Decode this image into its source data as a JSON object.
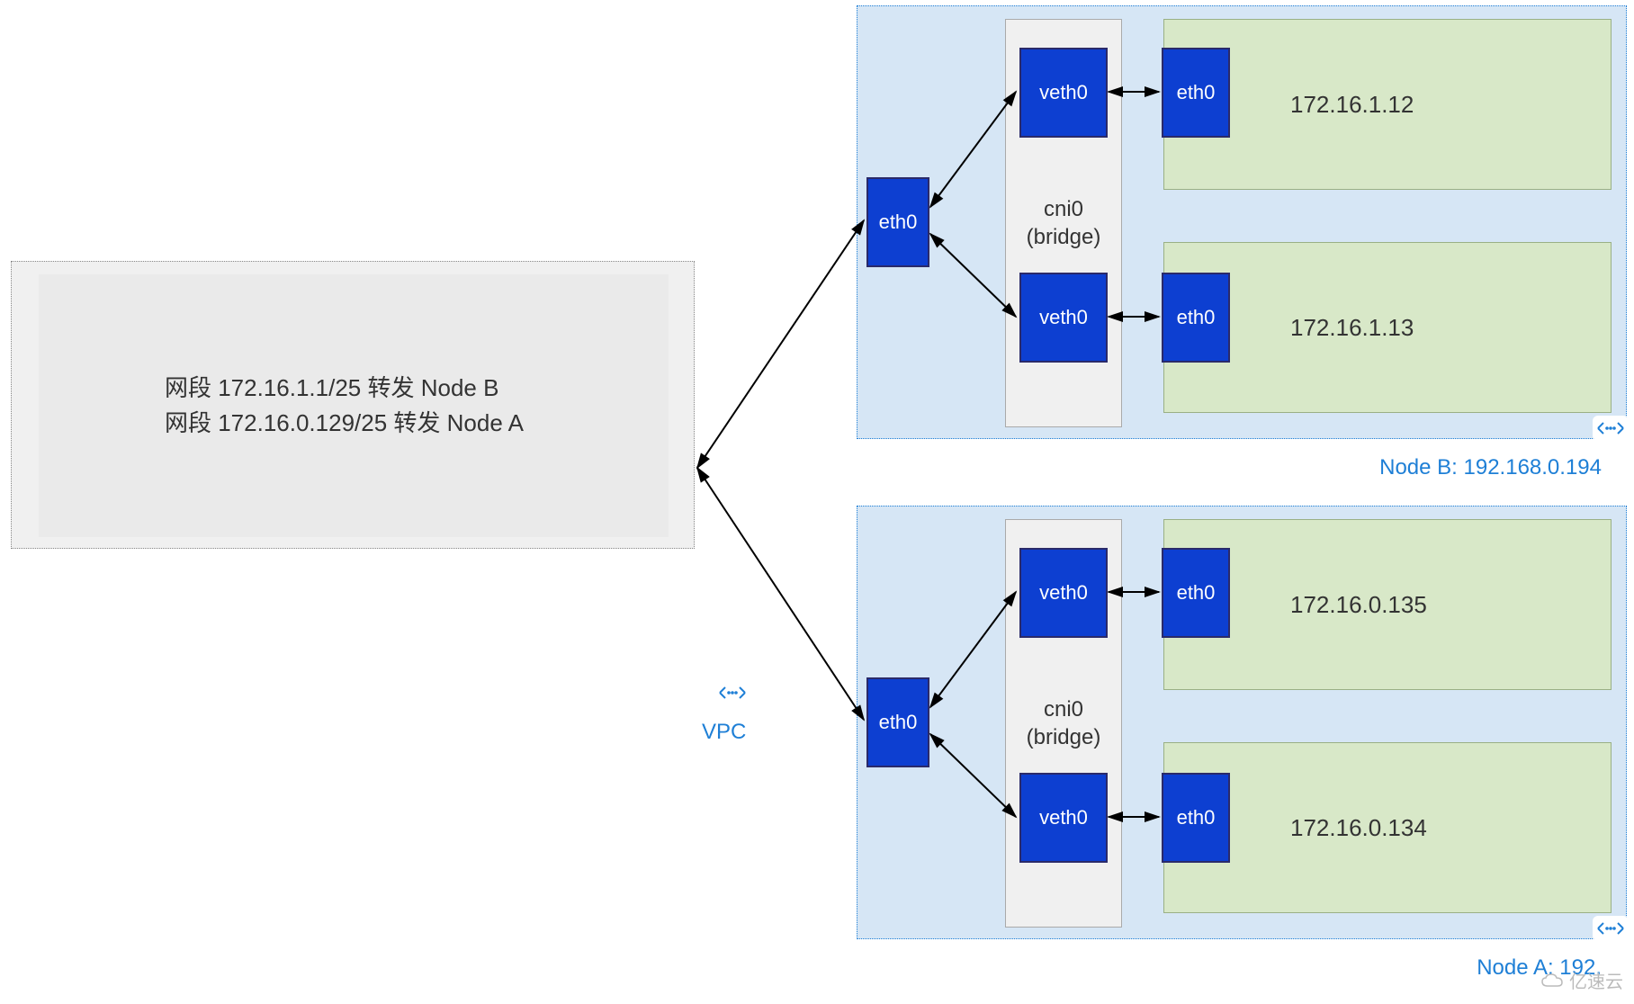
{
  "vpc": {
    "rule1": "网段 172.16.1.1/25 转发 Node B",
    "rule2": "网段 172.16.0.129/25 转发 Node A",
    "label": "VPC"
  },
  "nodes": {
    "b": {
      "label": "Node B: 192.168.0.194",
      "host_eth": "eth0",
      "bridge_name": "cni0",
      "bridge_sub": "(bridge)",
      "veth1": "veth0",
      "veth2": "veth0",
      "pod1_eth": "eth0",
      "pod2_eth": "eth0",
      "pod1_ip": "172.16.1.12",
      "pod2_ip": "172.16.1.13"
    },
    "a": {
      "label": "Node A: 192.",
      "host_eth": "eth0",
      "bridge_name": "cni0",
      "bridge_sub": "(bridge)",
      "veth1": "veth0",
      "veth2": "veth0",
      "pod1_eth": "eth0",
      "pod2_eth": "eth0",
      "pod1_ip": "172.16.0.135",
      "pod2_ip": "172.16.0.134"
    }
  },
  "watermark": "亿速云"
}
